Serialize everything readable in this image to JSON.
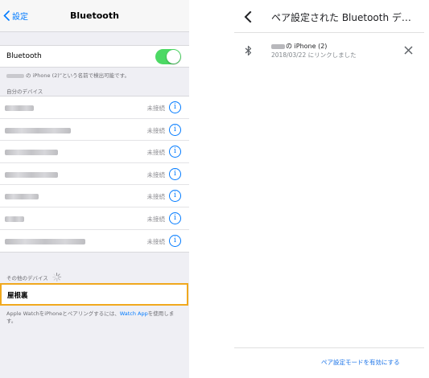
{
  "ios": {
    "nav": {
      "back_label": "設定",
      "title": "Bluetooth"
    },
    "bluetooth": {
      "label": "Bluetooth",
      "enabled": true,
      "toggle_color": "#4cd964"
    },
    "discoverable_note": "の iPhone (2)”という名前で検出可能です。",
    "my_devices_header": "自分のデバイス",
    "devices": [
      {
        "status": "未接続"
      },
      {
        "status": "未接続"
      },
      {
        "status": "未接続"
      },
      {
        "status": "未接続"
      },
      {
        "status": "未接続"
      },
      {
        "status": "未接続"
      },
      {
        "status": "未接続"
      }
    ],
    "other_devices_header": "その他のデバイス",
    "other_device": {
      "label": "屋根裏",
      "highlight_color": "#f0a81e"
    },
    "apple_watch_note": {
      "prefix": "Apple WatchをiPhoneとペアリングするには、",
      "link": "Watch App",
      "suffix": "を使用します。"
    },
    "accent_color": "#007aff"
  },
  "android": {
    "title": "ペア設定された Bluetooth デ…",
    "device": {
      "name": "の iPhone (2)",
      "subtitle": "2018/03/22 にリンクしました"
    },
    "pair_mode_link": "ペア設定モードを有効にする",
    "link_color": "#1a73e8"
  }
}
